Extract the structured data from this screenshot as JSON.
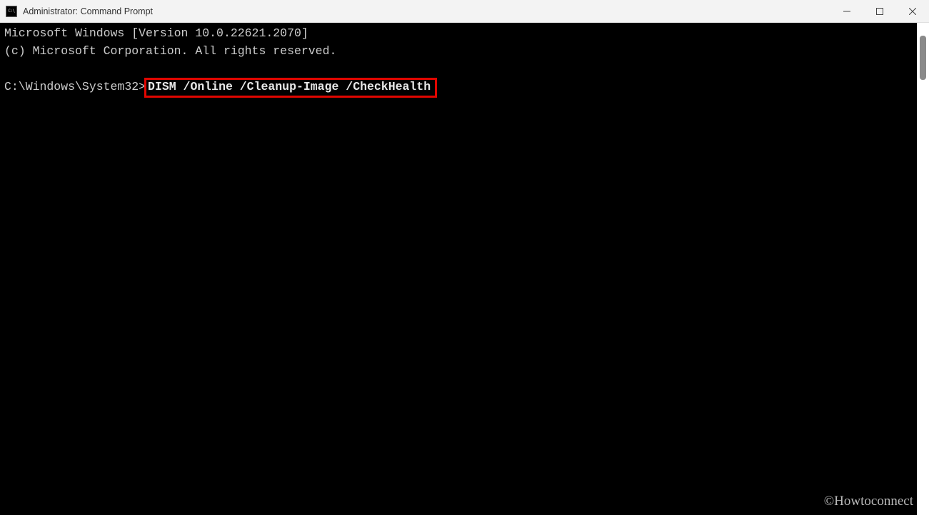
{
  "titlebar": {
    "icon_label": "C:\\",
    "title": "Administrator: Command Prompt"
  },
  "terminal": {
    "line1": "Microsoft Windows [Version 10.0.22621.2070]",
    "line2": "(c) Microsoft Corporation. All rights reserved.",
    "prompt": "C:\\Windows\\System32>",
    "command": "DISM /Online /Cleanup-Image /CheckHealth"
  },
  "watermark": "©Howtoconnect"
}
